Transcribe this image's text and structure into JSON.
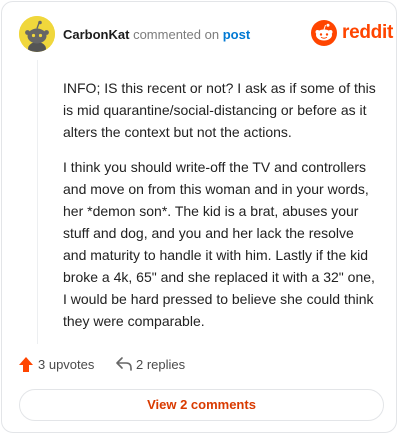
{
  "comment": {
    "author": "CarbonKat",
    "verb": "commented on",
    "post_link": "post",
    "paragraphs": [
      "INFO; IS this recent or not? I ask as if some of this is mid quarantine/social-distancing or before as it alters the context but not the actions.",
      "I think you should write-off the TV and controllers and move on from this woman and in your words, her *demon son*. The kid is a brat, abuses your stuff and dog, and you and her lack the resolve and maturity to handle it with him. Lastly if the kid broke a 4k, 65\" and she replaced it with a 32\" one, I would be hard pressed to believe she could think they were comparable."
    ]
  },
  "brand": {
    "logo_text": "reddit",
    "color": "#ff4500"
  },
  "actions": {
    "upvotes_label": "3 upvotes",
    "replies_label": "2 replies",
    "upvote_icon": "upvote-arrow-icon",
    "reply_icon": "reply-arrow-icon"
  },
  "view_comments_label": "View 2 comments",
  "colors": {
    "accent": "#d93a00",
    "link": "#0079d3",
    "avatar_bg": "#f0d73c"
  }
}
